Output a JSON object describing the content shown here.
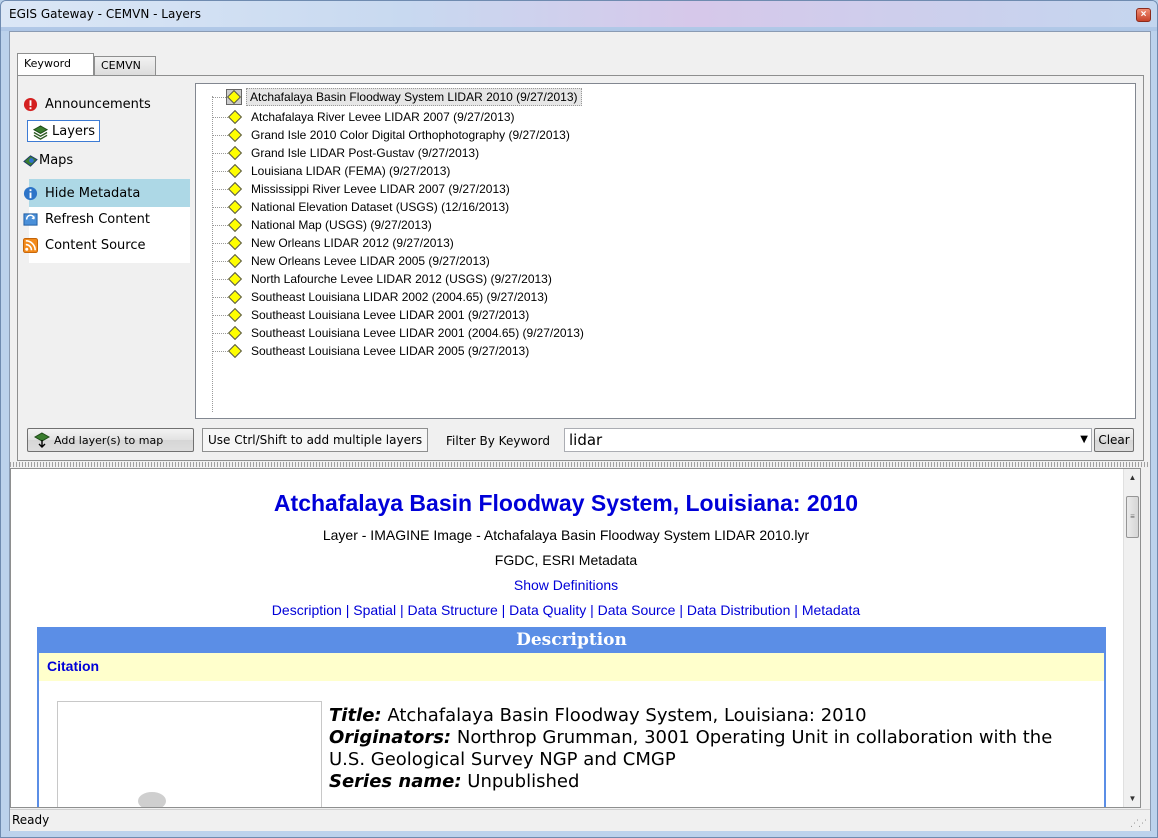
{
  "window": {
    "title": "EGIS Gateway - CEMVN - Layers",
    "close_label": "×"
  },
  "tabs": [
    {
      "label": "Keyword"
    },
    {
      "label": "CEMVN"
    }
  ],
  "nav": {
    "announcements": "Announcements",
    "layers": "Layers",
    "maps": "Maps",
    "hide_metadata": "Hide Metadata",
    "refresh_content": "Refresh Content",
    "content_source": "Content Source"
  },
  "layers": [
    "Atchafalaya Basin Floodway System LIDAR 2010 (9/27/2013)",
    "Atchafalaya River Levee LIDAR 2007 (9/27/2013)",
    "Grand Isle 2010 Color Digital Orthophotography (9/27/2013)",
    "Grand Isle LIDAR Post-Gustav (9/27/2013)",
    "Louisiana LIDAR (FEMA) (9/27/2013)",
    "Mississippi River Levee LIDAR 2007 (9/27/2013)",
    "National Elevation Dataset (USGS) (12/16/2013)",
    "National Map (USGS) (9/27/2013)",
    "New Orleans LIDAR 2012 (9/27/2013)",
    "New Orleans Levee LIDAR 2005 (9/27/2013)",
    "North Lafourche Levee LIDAR 2012 (USGS) (9/27/2013)",
    "Southeast Louisiana LIDAR 2002 (2004.65) (9/27/2013)",
    "Southeast Louisiana Levee LIDAR 2001 (9/27/2013)",
    "Southeast Louisiana Levee LIDAR 2001 (2004.65) (9/27/2013)",
    "Southeast Louisiana Levee LIDAR 2005 (9/27/2013)"
  ],
  "toolbar": {
    "add_layers": "Add layer(s) to map",
    "hint": "Use Ctrl/Shift to add multiple layers",
    "filter_label": "Filter By Keyword",
    "filter_value": "lidar",
    "clear": "Clear"
  },
  "metadata": {
    "title": "Atchafalaya Basin Floodway System, Louisiana: 2010",
    "layer_info": "Layer - IMAGINE Image - Atchafalaya Basin Floodway System LIDAR 2010.lyr",
    "formats": "FGDC, ESRI Metadata",
    "show_definitions": "Show Definitions",
    "sections": [
      "Description",
      "Spatial",
      "Data Structure",
      "Data Quality",
      "Data Source",
      "Data Distribution",
      "Metadata"
    ],
    "section_heading": "Description",
    "citation": "Citation",
    "fields": {
      "title_key": "Title:",
      "title_val": "Atchafalaya Basin Floodway System, Louisiana: 2010",
      "originators_key": "Originators:",
      "originators_val": "Northrop Grumman, 3001 Operating Unit in collaboration with the U.S. Geological Survey NGP and CMGP",
      "series_key": "Series name:",
      "series_val": "Unpublished"
    }
  },
  "status": {
    "text": "Ready"
  },
  "colors": {
    "link": "#0000d8",
    "section_header": "#5b8ee6",
    "citation_bg": "#ffffcc",
    "selected_nav_bg": "#add8e6",
    "layer_icon": "#ffff00"
  }
}
